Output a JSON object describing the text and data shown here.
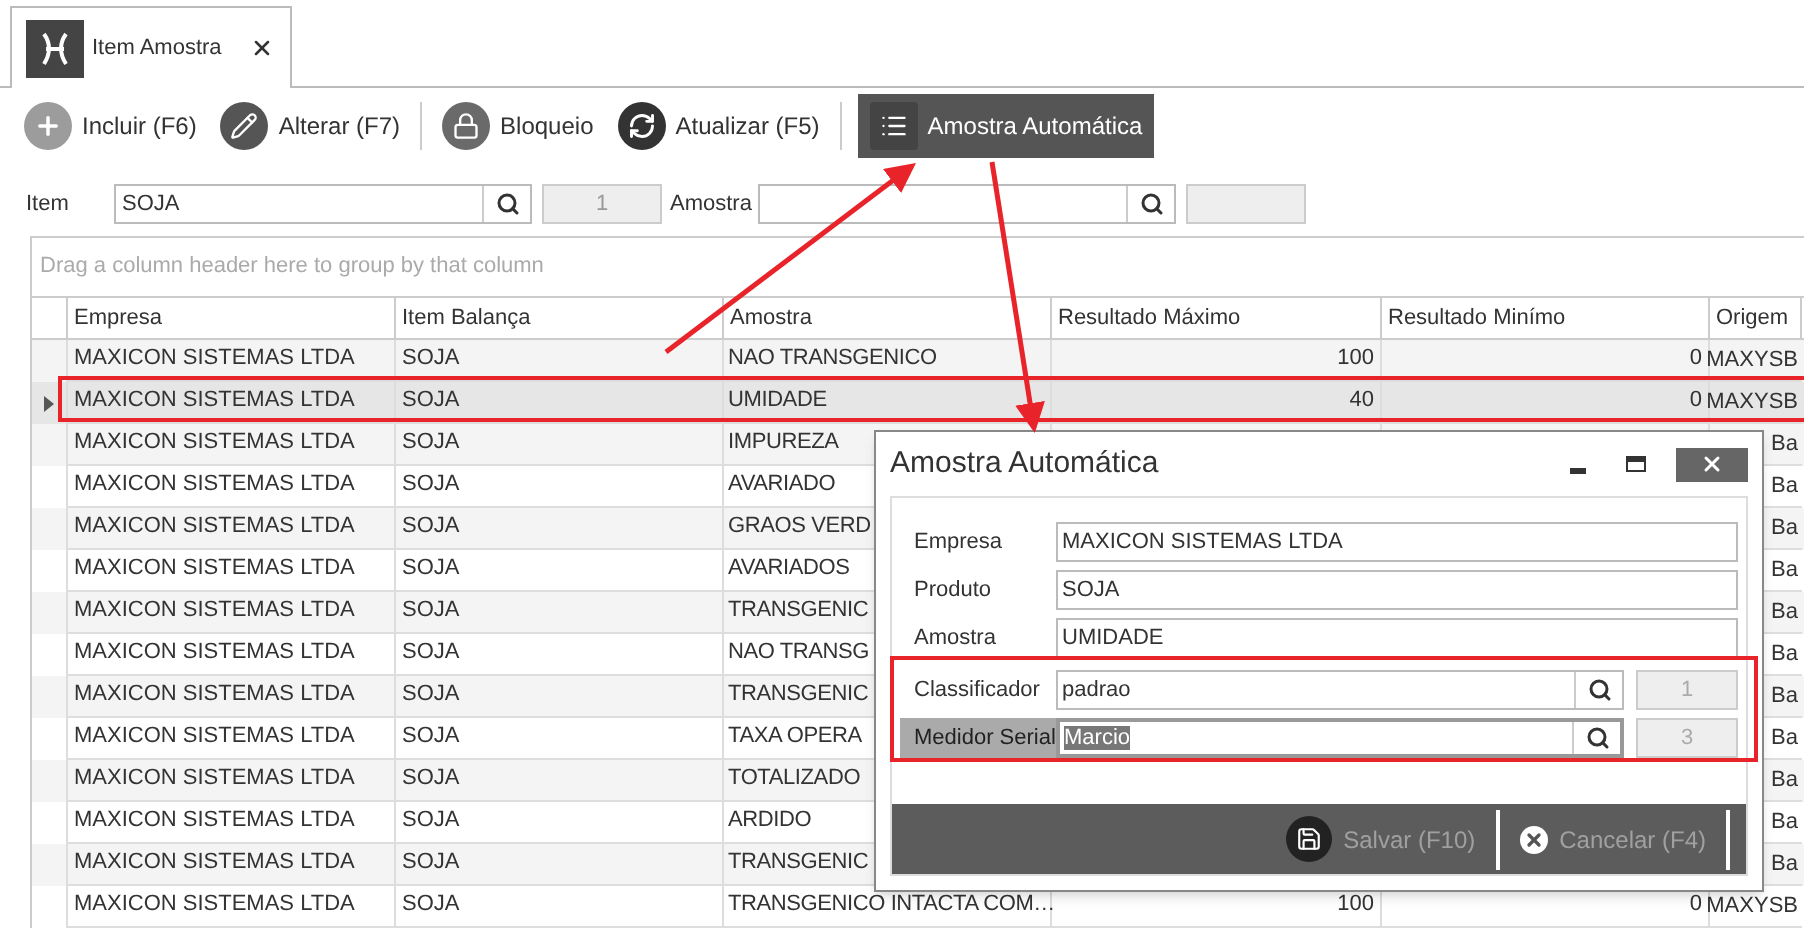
{
  "tab": {
    "label": "Item Amostra"
  },
  "toolbar": [
    {
      "label": "Incluir (F6)",
      "kind": "plus",
      "selected": false,
      "separator_after": false
    },
    {
      "label": "Alterar (F7)",
      "kind": "pencil",
      "selected": false,
      "separator_after": true
    },
    {
      "label": "Bloqueio",
      "kind": "lock",
      "selected": false,
      "separator_after": false
    },
    {
      "label": "Atualizar (F5)",
      "kind": "refresh",
      "selected": false,
      "separator_after": true
    },
    {
      "label": "Amostra Automática",
      "kind": "list",
      "selected": true,
      "separator_after": false
    }
  ],
  "filters": [
    {
      "label": "Item",
      "value": "SOJA",
      "code": "1"
    },
    {
      "label": "Amostra"
    }
  ],
  "group_panel": {
    "hint": "Drag a column header here to group by that column"
  },
  "grid": {
    "columns": [
      "Empresa",
      "Item Balança",
      "Amostra",
      "Resultado Máximo",
      "Resultado Minímo",
      "Origem"
    ],
    "rows": [
      {
        "empresa": "MAXICON SISTEMAS LTDA",
        "item": "SOJA",
        "amostra": "NAO TRANSGENICO",
        "max": "100",
        "min": "0",
        "origem": "MAXYSB",
        "selected": false
      },
      {
        "empresa": "MAXICON SISTEMAS LTDA",
        "item": "SOJA",
        "amostra": "UMIDADE",
        "max": "40",
        "min": "0",
        "origem": "MAXYSB",
        "selected": true
      },
      {
        "empresa": "MAXICON SISTEMAS LTDA",
        "item": "SOJA",
        "amostra": "IMPUREZA",
        "origem": "Ba",
        "selected": false
      },
      {
        "empresa": "MAXICON SISTEMAS LTDA",
        "item": "SOJA",
        "amostra": "AVARIADO",
        "origem": "Ba",
        "selected": false
      },
      {
        "empresa": "MAXICON SISTEMAS LTDA",
        "item": "SOJA",
        "amostra": "GRAOS VERD",
        "origem": "Ba",
        "selected": false
      },
      {
        "empresa": "MAXICON SISTEMAS LTDA",
        "item": "SOJA",
        "amostra": "AVARIADOS",
        "origem": "Ba",
        "selected": false
      },
      {
        "empresa": "MAXICON SISTEMAS LTDA",
        "item": "SOJA",
        "amostra": "TRANSGENIC",
        "origem": "Ba",
        "selected": false
      },
      {
        "empresa": "MAXICON SISTEMAS LTDA",
        "item": "SOJA",
        "amostra": "NAO TRANSG",
        "origem": "Ba",
        "selected": false
      },
      {
        "empresa": "MAXICON SISTEMAS LTDA",
        "item": "SOJA",
        "amostra": "TRANSGENIC",
        "origem": "Ba",
        "selected": false
      },
      {
        "empresa": "MAXICON SISTEMAS LTDA",
        "item": "SOJA",
        "amostra": "TAXA OPERA",
        "origem": "Ba",
        "selected": false
      },
      {
        "empresa": "MAXICON SISTEMAS LTDA",
        "item": "SOJA",
        "amostra": "TOTALIZADO",
        "origem": "Ba",
        "selected": false
      },
      {
        "empresa": "MAXICON SISTEMAS LTDA",
        "item": "SOJA",
        "amostra": "ARDIDO",
        "origem": "Ba",
        "selected": false
      },
      {
        "empresa": "MAXICON SISTEMAS LTDA",
        "item": "SOJA",
        "amostra": "TRANSGENIC",
        "origem": "Ba",
        "selected": false
      },
      {
        "empresa": "MAXICON SISTEMAS LTDA",
        "item": "SOJA",
        "amostra": "TRANSGENICO INTACTA COM…",
        "max": "100",
        "min": "0",
        "origem": "MAXYSB",
        "selected": false
      }
    ]
  },
  "dialog": {
    "title": "Amostra Automática",
    "fields": [
      {
        "label": "Empresa",
        "value": "MAXICON SISTEMAS LTDA",
        "kind": "text",
        "focused": false
      },
      {
        "label": "Produto",
        "value": "SOJA",
        "kind": "text",
        "focused": false
      },
      {
        "label": "Amostra",
        "value": "UMIDADE",
        "kind": "text",
        "focused": false
      },
      {
        "label": "Classificador",
        "value": "padrao",
        "kind": "lookup",
        "code": "1",
        "focused": false
      },
      {
        "label": "Medidor Serial",
        "value": "Marcio",
        "kind": "lookup",
        "code": "3",
        "focused": true
      }
    ],
    "buttons": [
      {
        "label": "Salvar (F10)",
        "kind": "save",
        "disabled": true
      },
      {
        "label": "Cancelar (F4)",
        "kind": "cancel",
        "disabled": true
      }
    ]
  }
}
